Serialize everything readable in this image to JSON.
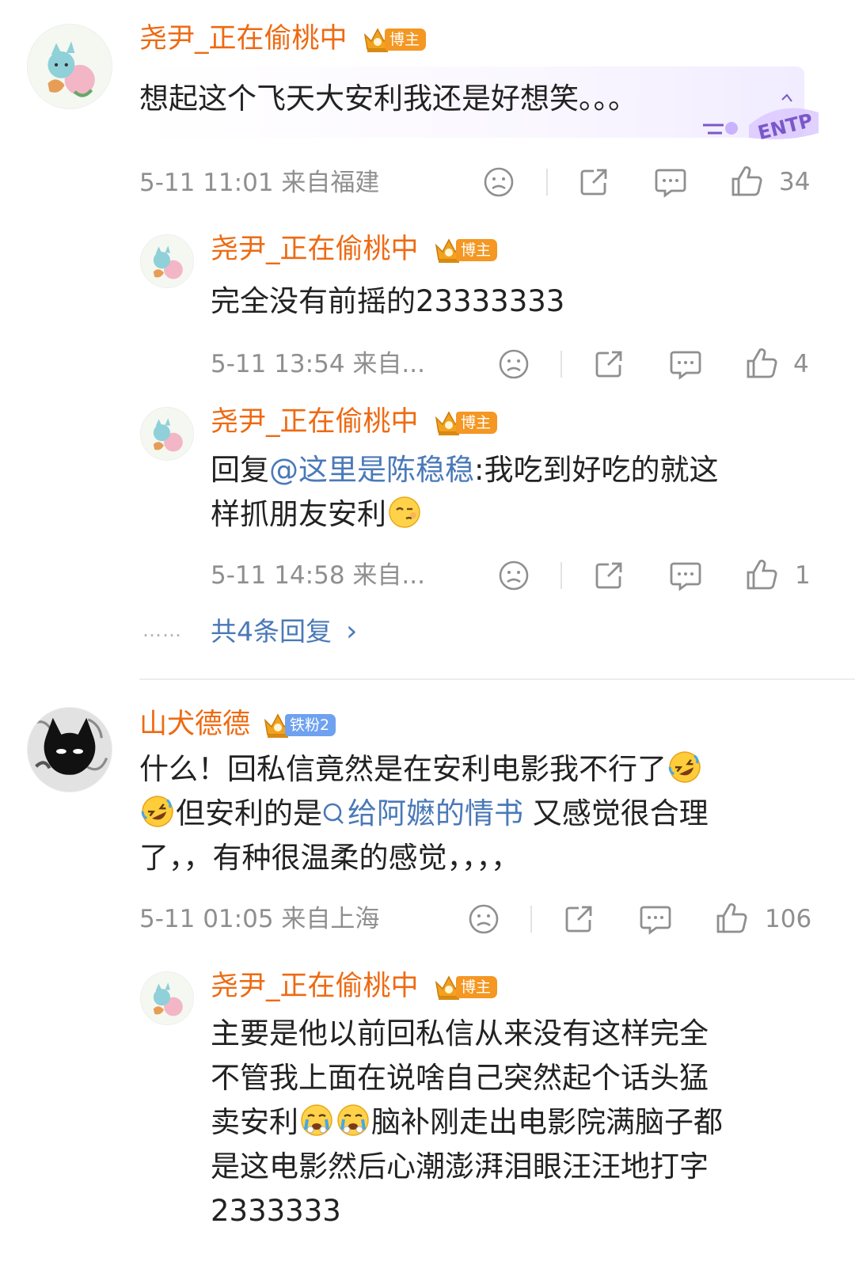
{
  "comments": [
    {
      "user": "尧尹_正在偷桃中",
      "badge": "博主",
      "text_lines": [
        "想起这个飞天大安利我还是好想笑。。。"
      ],
      "meta": "5-11 11:01  来自福建",
      "likes": "34",
      "sticker": "ENTP"
    },
    {
      "user": "尧尹_正在偷桃中",
      "badge": "博主",
      "text": "完全没有前摇的23333333",
      "meta": "5-11 13:54  来自...",
      "likes": "4"
    },
    {
      "user": "尧尹_正在偷桃中",
      "badge": "博主",
      "reply_prefix": "回复",
      "mention": "@这里是陈稳稳",
      "text_rest": ":我吃到好吃的就这",
      "text_line2": "样抓朋友安利",
      "meta": "5-11 14:58  来自...",
      "likes": "1"
    },
    {
      "user": "山犬德德",
      "badge": "铁粉2",
      "line1": "什么！回私信竟然是在安利电影我不行了",
      "line2_a": "但安利的是",
      "line2_link": "给阿嬷的情书",
      "line2_b": " 又感觉很合理",
      "line3": "了，，有种很温柔的感觉，，，，",
      "meta": "5-11 01:05  来自上海",
      "likes": "106"
    },
    {
      "user": "尧尹_正在偷桃中",
      "badge": "博主",
      "lines": [
        "主要是他以前回私信从来没有这样完全",
        "不管我上面在说啥自己突然起个话头猛",
        "脑补刚走出电影院满脑子都",
        "是这电影然后心潮澎湃泪眼汪汪地打字",
        "2333333"
      ],
      "line3_prefix": "卖安利"
    }
  ],
  "more_replies": {
    "dots": "……",
    "label": "共4条回复",
    "chevron": "›"
  },
  "icons": [
    "sad-face-icon",
    "share-icon",
    "comment-icon",
    "thumbs-up-icon",
    "crown-icon",
    "search-icon",
    "rofl-emoji-icon",
    "wink-emoji-icon",
    "crying-emoji-icon"
  ],
  "colors": {
    "username": "#ee6a12",
    "host_badge": "#f49723",
    "fan_badge": "#6ea1f0",
    "link": "#4a79b8",
    "meta": "#8f8f8f"
  }
}
